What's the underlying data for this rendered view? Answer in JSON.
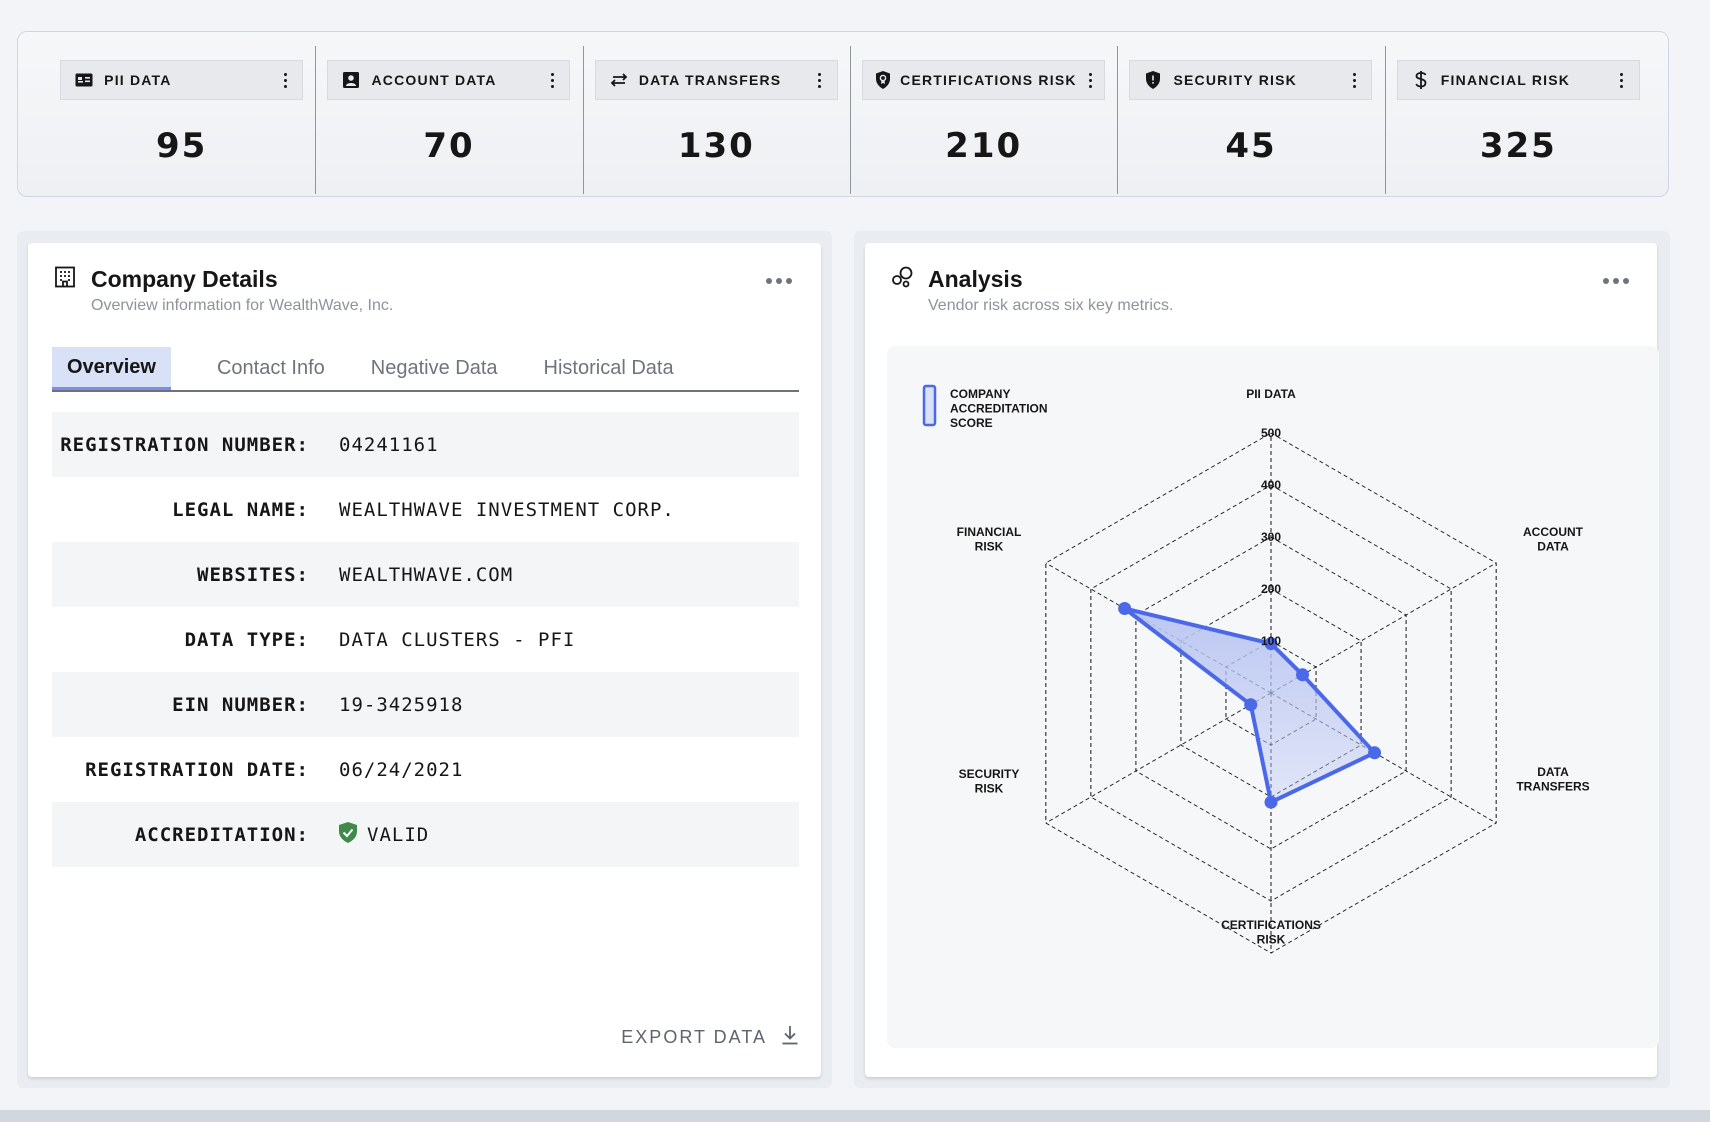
{
  "metrics": [
    {
      "label": "PII DATA",
      "value": "95",
      "icon": "id-card-icon"
    },
    {
      "label": "ACCOUNT DATA",
      "value": "70",
      "icon": "user-profile-icon"
    },
    {
      "label": "DATA TRANSFERS",
      "value": "130",
      "icon": "arrows-left-right-icon"
    },
    {
      "label": "CERTIFICATIONS RISK",
      "value": "210",
      "icon": "certificate-icon"
    },
    {
      "label": "SECURITY RISK",
      "value": "45",
      "icon": "shield-icon"
    },
    {
      "label": "FINANCIAL RISK",
      "value": "325",
      "icon": "dollar-icon"
    }
  ],
  "company": {
    "title": "Company Details",
    "subtitle": "Overview information for WealthWave, Inc.",
    "tabs": [
      "Overview",
      "Contact Info",
      "Negative Data",
      "Historical Data"
    ],
    "active_tab": "Overview",
    "rows": [
      {
        "key": "REGISTRATION NUMBER:",
        "value": "04241161"
      },
      {
        "key": "LEGAL NAME:",
        "value": "WEALTHWAVE INVESTMENT CORP."
      },
      {
        "key": "WEBSITES:",
        "value": "WEALTHWAVE.COM"
      },
      {
        "key": "DATA TYPE:",
        "value": "DATA CLUSTERS - PFI"
      },
      {
        "key": "EIN NUMBER:",
        "value": "19-3425918"
      },
      {
        "key": "REGISTRATION DATE:",
        "value": "06/24/2021"
      },
      {
        "key": "ACCREDITATION:",
        "value": "VALID"
      }
    ],
    "export_label": "EXPORT DATA"
  },
  "analysis": {
    "title": "Analysis",
    "subtitle": "Vendor risk across six key metrics."
  },
  "colors": {
    "accent": "#4a68e8",
    "fill": "#b9c5f2",
    "valid_green": "#3f8a4b"
  },
  "chart_data": {
    "type": "radar",
    "categories": [
      "PII DATA",
      "ACCOUNT DATA",
      "DATA TRANSFERS",
      "CERTIFICATIONS RISK",
      "SECURITY RISK",
      "FINANCIAL RISK"
    ],
    "category_labels": [
      [
        "PII DATA"
      ],
      [
        "ACCOUNT",
        "DATA"
      ],
      [
        "DATA",
        "TRANSFERS"
      ],
      [
        "CERTIFICATIONS",
        "RISK"
      ],
      [
        "SECURITY",
        "RISK"
      ],
      [
        "FINANCIAL",
        "RISK"
      ]
    ],
    "series": [
      {
        "name": "COMPANY ACCREDITATION SCORE",
        "name_lines": [
          "COMPANY",
          "ACCREDITATION",
          "SCORE"
        ],
        "values": [
          95,
          70,
          230,
          210,
          45,
          325
        ]
      }
    ],
    "rlim": [
      0,
      500
    ],
    "ticks": [
      100,
      200,
      300,
      400,
      500
    ],
    "legend_position": "top-left",
    "grid": true
  }
}
